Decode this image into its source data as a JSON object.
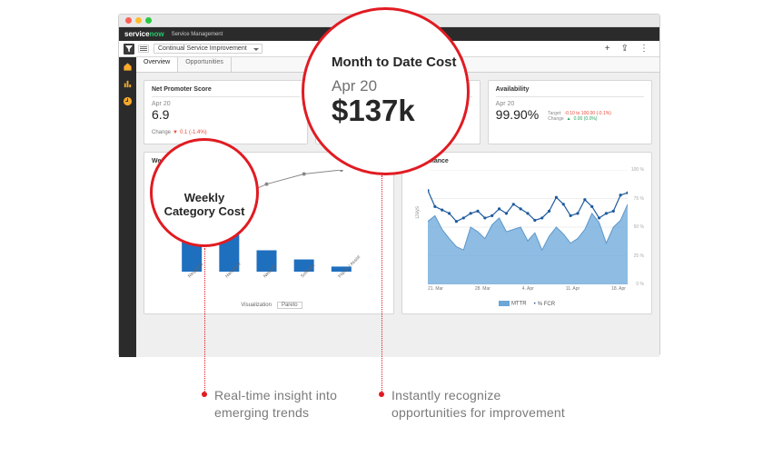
{
  "logo": {
    "brand1": "service",
    "brand2": "now",
    "sub": "Service Management"
  },
  "nav": {
    "selector": "Continual Service Improvement",
    "plus": "+",
    "share": "⇪",
    "more": "⋮"
  },
  "tabs": {
    "overview": "Overview",
    "opportunities": "Opportunities"
  },
  "cards": {
    "nps": {
      "title": "Net Promoter Score",
      "date": "Apr 20",
      "value": "6.9",
      "change_label": "Change",
      "change_dir": "▼",
      "change_val": "0.1 (-1.4%)"
    },
    "mtd": {
      "title": "Month to Date Cost"
    },
    "avail": {
      "title": "Availability",
      "date": "Apr 20",
      "value": "99.90%",
      "target_label": "Target:",
      "target_val": "-0.10 to 100.00 (-0.1%)",
      "change_label": "Change",
      "change_dir": "▲",
      "change_val": "0.00 (0.0%)"
    }
  },
  "weekly": {
    "title": "Weekly Category Cost",
    "viz_label": "Visualization",
    "viz_val": "Pareto"
  },
  "perf": {
    "title": "Performance",
    "ylabel": "Days",
    "legend1": "MTTR",
    "legend2": "% FCR"
  },
  "callouts": {
    "big": {
      "title": "Month to Date Cost",
      "date": "Apr 20",
      "value": "$137k"
    },
    "small": {
      "line1": "Weekly",
      "line2": "Category Cost"
    }
  },
  "captions": {
    "c1": "Real-time insight into emerging trends",
    "c2": "Instantly recognize opportunities for improvement"
  },
  "chart_data": [
    {
      "type": "bar",
      "title": "Weekly Category Cost (Pareto)",
      "categories": [
        "Requests",
        "Hardware",
        "Network",
        "Software",
        "Inquiry / Assist"
      ],
      "values": [
        70,
        47,
        21,
        12,
        5
      ],
      "cumulative_pct": [
        40,
        70,
        86,
        96,
        100
      ],
      "ylim": [
        0,
        100
      ],
      "yticks": [
        0,
        50,
        100
      ],
      "ylabel": "",
      "right_axis": "%"
    },
    {
      "type": "area",
      "title": "Performance",
      "x": [
        "21. Mar",
        "28. Mar",
        "4. Apr",
        "11. Apr",
        "18. Apr"
      ],
      "series": [
        {
          "name": "MTTR",
          "type": "area",
          "values": [
            55,
            60,
            48,
            40,
            33,
            30,
            50,
            46,
            40,
            52,
            58,
            46,
            48,
            50,
            38,
            45,
            30,
            42,
            50,
            44,
            36,
            40,
            48,
            62,
            54,
            36,
            50,
            56,
            70
          ]
        },
        {
          "name": "% FCR",
          "type": "line",
          "values": [
            82,
            68,
            65,
            62,
            55,
            58,
            62,
            64,
            58,
            60,
            66,
            62,
            70,
            66,
            62,
            56,
            58,
            64,
            76,
            70,
            60,
            62,
            74,
            68,
            58,
            62,
            64,
            78,
            80
          ]
        }
      ],
      "ylabel": "Days",
      "right_ticks_pct": [
        0,
        25,
        50,
        75,
        100
      ]
    }
  ]
}
